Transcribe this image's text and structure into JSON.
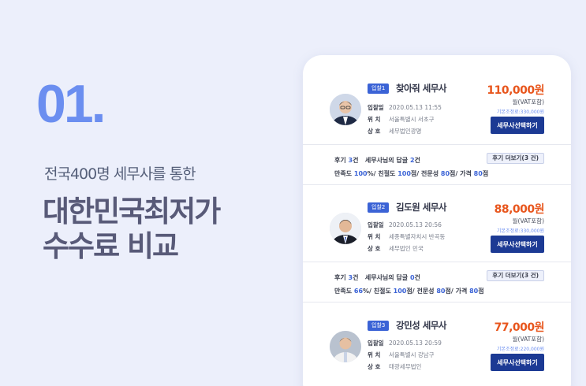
{
  "hero": {
    "number": "01.",
    "subtitle": "전국400명 세무사를 통한",
    "title_line1": "대한민국최저가",
    "title_line2": "수수료 비교"
  },
  "advisors": [
    {
      "badge": "입찰1",
      "name": "찾아줘 세무사",
      "price": "110,000원",
      "vat": "월(VAT포함)",
      "base": "기본조정료:330,000원",
      "select_label": "세무사선택하기",
      "bid_label": "입찰일",
      "bid_value": "2020.05.13 11:55",
      "loc_label": "위  치",
      "loc_value": "서울특별시 서초구",
      "firm_label": "상  호",
      "firm_value": "세무법인광명"
    },
    {
      "badge": "입찰2",
      "name": "김도원 세무사",
      "price": "88,000원",
      "vat": "월(VAT포함)",
      "base": "기본조정료:330,000원",
      "select_label": "세무사선택하기",
      "bid_label": "입찰일",
      "bid_value": "2020.05.13 20:56",
      "loc_label": "위  치",
      "loc_value": "세종특별자치시 반곡동",
      "firm_label": "상  호",
      "firm_value": "세무법인 민국"
    },
    {
      "badge": "입찰3",
      "name": "강민성 세무사",
      "price": "77,000원",
      "vat": "월(VAT포함)",
      "base": "기본조정료:220,000원",
      "select_label": "세무사선택하기",
      "bid_label": "입찰일",
      "bid_value": "2020.05.13 20:59",
      "loc_label": "위  치",
      "loc_value": "서울특별시 강남구",
      "firm_label": "상  호",
      "firm_value": "태광세무법인"
    }
  ],
  "reviews": [
    {
      "count_prefix": "후기",
      "count_num": "3",
      "count_suffix": "건",
      "reply_prefix": "세무사님의 답글",
      "reply_num": "2",
      "reply_suffix": "건",
      "more_label": "후기 더보기(3 건)",
      "s1_label": "만족도",
      "s1_val": "100",
      "s1_unit": "%/",
      "s2_label": "친절도",
      "s2_val": "100",
      "s2_unit": "점/",
      "s3_label": "전문성",
      "s3_val": "80",
      "s3_unit": "점/",
      "s4_label": "가격",
      "s4_val": "80",
      "s4_unit": "점"
    },
    {
      "count_prefix": "후기",
      "count_num": "3",
      "count_suffix": "건",
      "reply_prefix": "세무사님의 답글",
      "reply_num": "0",
      "reply_suffix": "건",
      "more_label": "후기 더보기(3 건)",
      "s1_label": "만족도",
      "s1_val": "66",
      "s1_unit": "%/",
      "s2_label": "친절도",
      "s2_val": "100",
      "s2_unit": "점/",
      "s3_label": "전문성",
      "s3_val": "80",
      "s3_unit": "점/",
      "s4_label": "가격",
      "s4_val": "80",
      "s4_unit": "점"
    }
  ],
  "colors": {
    "accent": "#6b8ef0",
    "price": "#e8561d",
    "button": "#1c3a94",
    "badge": "#3b63d6",
    "background": "#eceffb"
  }
}
